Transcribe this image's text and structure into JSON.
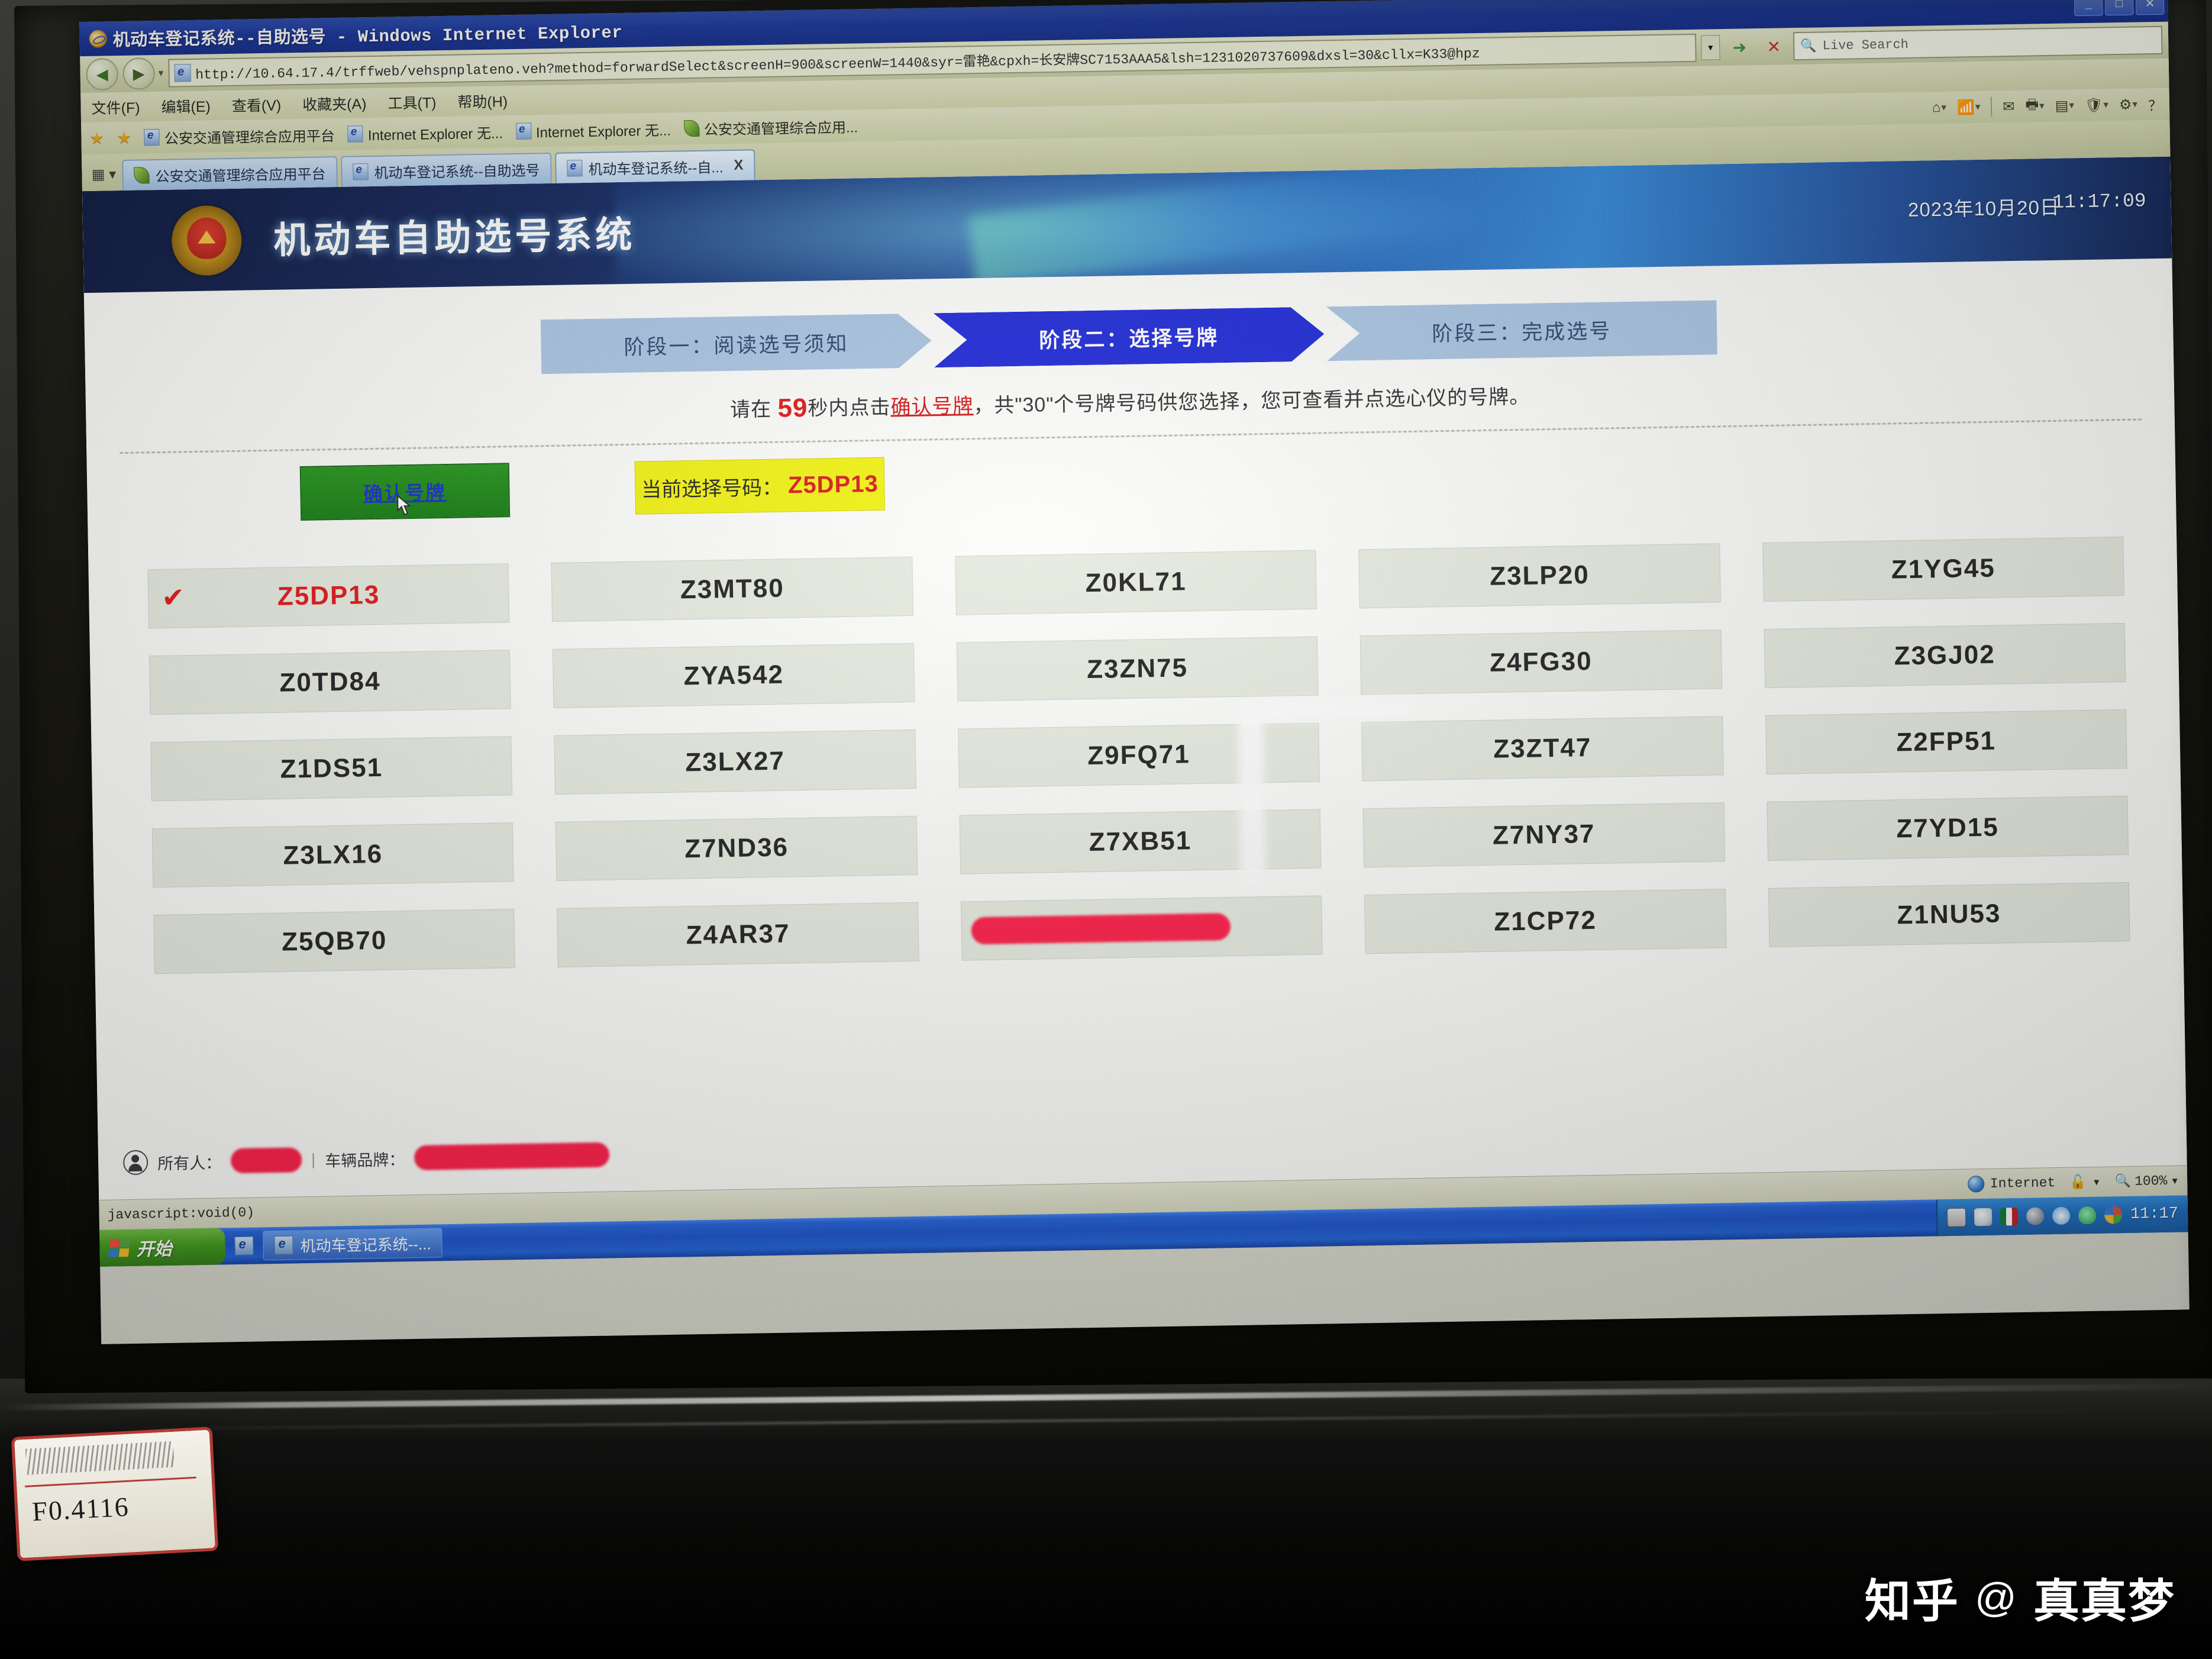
{
  "window": {
    "title": "机动车登记系统--自助选号 - Windows Internet Explorer",
    "minimize_label": "_",
    "maximize_label": "□",
    "close_label": "✕"
  },
  "browser": {
    "back_label": "◀",
    "forward_label": "▶",
    "url": "http://10.64.17.4/trffweb/vehspnplateno.veh?method=forwardSelect&screenH=900&screenW=1440&syr=雷艳&cpxh=长安牌SC7153AAA5&lsh=1231020737609&dxsl=30&cllx=K33@hpz",
    "url_dropdown_icon": "chevron-down-icon",
    "go_label": "➜",
    "stop_label": "✕",
    "search_placeholder": "Live Search",
    "search_icon": "search-icon",
    "menu": [
      "文件(F)",
      "编辑(E)",
      "查看(V)",
      "收藏夹(A)",
      "工具(T)",
      "帮助(H)"
    ],
    "favorites": {
      "star_icon": "star-icon",
      "add_star_icon": "add-favorite-icon",
      "items": [
        {
          "label": "公安交通管理综合应用平台",
          "icon": "ie-icon"
        },
        {
          "label": "Internet Explorer 无...",
          "icon": "ie-icon"
        },
        {
          "label": "Internet Explorer 无...",
          "icon": "ie-icon"
        },
        {
          "label": "公安交通管理综合应用...",
          "icon": "leaf-icon"
        }
      ]
    },
    "toolbar_icons": [
      "home-icon",
      "feeds-icon",
      "print-icon",
      "page-icon",
      "safety-icon",
      "tools-icon",
      "help-icon"
    ],
    "quick_tabs_icon": "quick-tabs-icon",
    "tabs": [
      {
        "label": "公安交通管理综合应用平台",
        "icon": "leaf-icon",
        "active": false
      },
      {
        "label": "机动车登记系统--自助选号",
        "icon": "ie-icon",
        "active": false
      },
      {
        "label": "机动车登记系统--自...",
        "icon": "ie-icon",
        "active": true,
        "close_label": "X"
      }
    ]
  },
  "page": {
    "header": {
      "emblem_icon": "police-emblem-icon",
      "title": "机动车自助选号系统",
      "date": "2023年10月20日",
      "time": "11:17:09"
    },
    "steps": [
      {
        "label": "阶段一：阅读选号须知",
        "active": false
      },
      {
        "label": "阶段二：选择号牌",
        "active": true
      },
      {
        "label": "阶段三：完成选号",
        "active": false
      }
    ],
    "notice": {
      "prefix": "请在 ",
      "seconds": "59",
      "mid1": "秒内点击",
      "link": "确认号牌",
      "mid2": "，共\"30\"个号牌号码供您选择，您可查看并点选心仪的号牌。"
    },
    "confirm_button": "确认号牌",
    "current_selection": {
      "label": "当前选择号码：",
      "value": "Z5DP13"
    },
    "plates": [
      {
        "text": "Z5DP13",
        "selected": true,
        "redacted": false,
        "tick": "✔"
      },
      {
        "text": "Z3MT80",
        "selected": false,
        "redacted": false
      },
      {
        "text": "Z0KL71",
        "selected": false,
        "redacted": false
      },
      {
        "text": "Z3LP20",
        "selected": false,
        "redacted": false
      },
      {
        "text": "Z1YG45",
        "selected": false,
        "redacted": false
      },
      {
        "text": "Z0TD84",
        "selected": false,
        "redacted": false
      },
      {
        "text": "ZYA542",
        "selected": false,
        "redacted": false
      },
      {
        "text": "Z3ZN75",
        "selected": false,
        "redacted": false
      },
      {
        "text": "Z4FG30",
        "selected": false,
        "redacted": false
      },
      {
        "text": "Z3GJ02",
        "selected": false,
        "redacted": false
      },
      {
        "text": "Z1DS51",
        "selected": false,
        "redacted": false
      },
      {
        "text": "Z3LX27",
        "selected": false,
        "redacted": false
      },
      {
        "text": "Z9FQ71",
        "selected": false,
        "redacted": false
      },
      {
        "text": "Z3ZT47",
        "selected": false,
        "redacted": false
      },
      {
        "text": "Z2FP51",
        "selected": false,
        "redacted": false
      },
      {
        "text": "Z3LX16",
        "selected": false,
        "redacted": false
      },
      {
        "text": "Z7ND36",
        "selected": false,
        "redacted": false
      },
      {
        "text": "Z7XB51",
        "selected": false,
        "redacted": false
      },
      {
        "text": "Z7NY37",
        "selected": false,
        "redacted": false
      },
      {
        "text": "Z7YD15",
        "selected": false,
        "redacted": false
      },
      {
        "text": "Z5QB70",
        "selected": false,
        "redacted": false
      },
      {
        "text": "Z4AR37",
        "selected": false,
        "redacted": false
      },
      {
        "text": "",
        "selected": false,
        "redacted": true
      },
      {
        "text": "Z1CP72",
        "selected": false,
        "redacted": false
      },
      {
        "text": "Z1NU53",
        "selected": false,
        "redacted": false
      }
    ],
    "footer": {
      "owner_icon": "person-icon",
      "owner_label": "所有人：",
      "owner_value": "",
      "separator": "|",
      "brand_label": "车辆品牌：",
      "brand_value": ""
    }
  },
  "status_bar": {
    "message": "javascript:void(0)",
    "zone_icon": "internet-zone-icon",
    "zone_label": "Internet",
    "protected_icon": "lock-icon",
    "protected_dropdown": "▾",
    "zoom_icon": "zoom-icon",
    "zoom_level": "100%",
    "zoom_dropdown": "▾"
  },
  "taskbar": {
    "start_label": "开始",
    "start_icon": "windows-flag-icon",
    "quick_launch": [
      "ie-quick-icon"
    ],
    "items": [
      {
        "label": "机动车登记系统--...",
        "icon": "ie-icon"
      }
    ],
    "tray_icons": [
      "keyboard-ime-icon",
      "flask-icon",
      "vnc-icon",
      "disc-icon",
      "update-arrow-icon",
      "shield-icon",
      "security-center-icon"
    ],
    "clock": "11:17"
  },
  "photo": {
    "tag_code": "F0.4116",
    "watermark_site": "知乎",
    "watermark_at": "@",
    "watermark_user": "真真梦"
  }
}
